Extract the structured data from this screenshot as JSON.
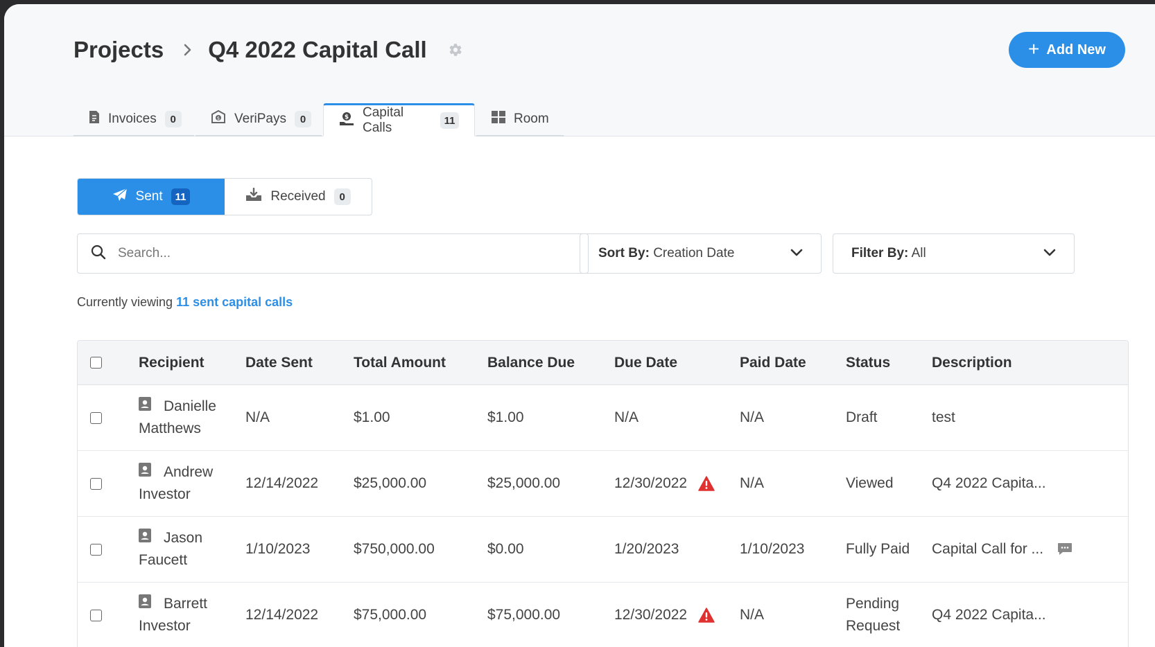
{
  "header": {
    "breadcrumb_root": "Projects",
    "project_title": "Q4 2022 Capital Call",
    "add_button_label": "Add New"
  },
  "tabs": [
    {
      "label": "Invoices",
      "count": "0",
      "icon": "invoice-icon"
    },
    {
      "label": "VeriPays",
      "count": "0",
      "icon": "envelope-money-icon"
    },
    {
      "label": "Capital Calls",
      "count": "11",
      "icon": "money-hand-icon",
      "active": true
    },
    {
      "label": "Room",
      "icon": "grid-icon"
    }
  ],
  "segments": {
    "sent_label": "Sent",
    "sent_count": "11",
    "received_label": "Received",
    "received_count": "0"
  },
  "search": {
    "placeholder": "Search..."
  },
  "sort": {
    "label": "Sort By",
    "value": "Creation Date"
  },
  "filter": {
    "label": "Filter By",
    "value": "All"
  },
  "viewing": {
    "prefix": "Currently viewing",
    "link": "11 sent capital calls"
  },
  "table": {
    "headers": [
      "Recipient",
      "Date Sent",
      "Total Amount",
      "Balance Due",
      "Due Date",
      "Paid Date",
      "Status",
      "Description"
    ],
    "rows": [
      {
        "first": "Danielle",
        "last": "Matthews",
        "date_sent": "N/A",
        "total": "$1.00",
        "balance": "$1.00",
        "due": "N/A",
        "due_warning": false,
        "paid": "N/A",
        "status1": "Draft",
        "status2": "",
        "description": "test",
        "comment": false
      },
      {
        "first": "Andrew",
        "last": "Investor",
        "date_sent": "12/14/2022",
        "total": "$25,000.00",
        "balance": "$25,000.00",
        "due": "12/30/2022",
        "due_warning": true,
        "paid": "N/A",
        "status1": "Viewed",
        "status2": "",
        "description": "Q4 2022 Capita...",
        "comment": false
      },
      {
        "first": "Jason",
        "last": "Faucett",
        "date_sent": "1/10/2023",
        "total": "$750,000.00",
        "balance": "$0.00",
        "due": "1/20/2023",
        "due_warning": false,
        "paid": "1/10/2023",
        "status1": "Fully Paid",
        "status2": "",
        "description": "Capital Call for ...",
        "comment": true
      },
      {
        "first": "Barrett",
        "last": "Investor",
        "date_sent": "12/14/2022",
        "total": "$75,000.00",
        "balance": "$75,000.00",
        "due": "12/30/2022",
        "due_warning": true,
        "paid": "N/A",
        "status1": "Pending",
        "status2": "Request",
        "description": "Q4 2022 Capita...",
        "comment": false
      }
    ]
  },
  "colors": {
    "accent": "#2b8fe8",
    "warning": "#e03131",
    "badge_active": "#1565c0"
  }
}
